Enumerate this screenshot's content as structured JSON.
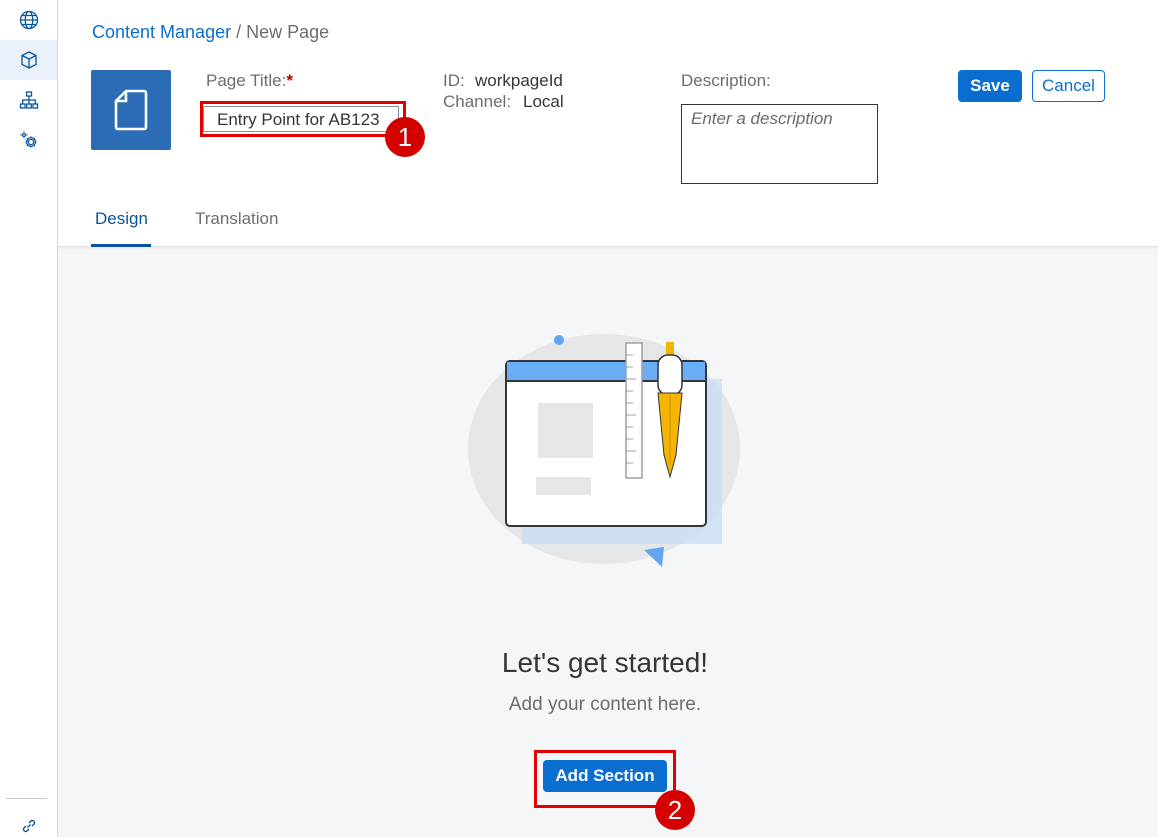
{
  "rail": {
    "items": [
      {
        "icon": "globe-icon"
      },
      {
        "icon": "cube-icon"
      },
      {
        "icon": "sitemap-icon"
      },
      {
        "icon": "gears-icon"
      }
    ],
    "bottom_icon": "link-icon"
  },
  "breadcrumb": {
    "link": "Content Manager",
    "separator": " / ",
    "current": "New Page"
  },
  "page": {
    "title_label": "Page Title:",
    "required_mark": "*",
    "title_value": "Entry Point for AB123",
    "id_label": "ID:",
    "id_value": "workpageId",
    "channel_label": "Channel:",
    "channel_value": "Local",
    "description_label": "Description:",
    "description_placeholder": "Enter a description"
  },
  "actions": {
    "save": "Save",
    "cancel": "Cancel"
  },
  "tabs": [
    {
      "label": "Design",
      "active": true
    },
    {
      "label": "Translation",
      "active": false
    }
  ],
  "empty_state": {
    "title": "Let's get started!",
    "subtitle": "Add your content here.",
    "button": "Add Section"
  },
  "annotations": {
    "marker_1": "1",
    "marker_2": "2"
  },
  "colors": {
    "accent": "#0a6ed1",
    "annotation": "#e00000",
    "page_icon_bg": "#2b6cb5"
  }
}
